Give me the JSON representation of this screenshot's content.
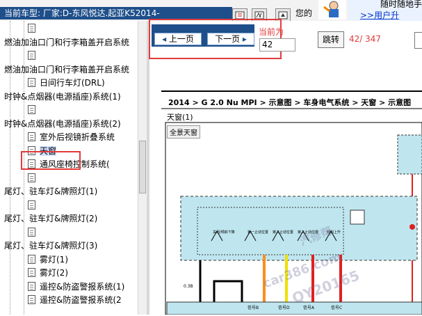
{
  "header": {
    "title": "当前车型:  厂家:D-东风悦达.起亚K52014-",
    "notice": "您的",
    "ad_line1": "随时随地手",
    "ad_link": ">>用户升"
  },
  "sidebar": {
    "items": [
      {
        "label": "",
        "level": 2,
        "icon": "doc"
      },
      {
        "label": "燃油加油口门和行李箱盖开启系统",
        "level": 0,
        "icon": "folder"
      },
      {
        "label": "",
        "level": 2,
        "icon": "doc"
      },
      {
        "label": "燃油加油口门和行李箱盖开启系统",
        "level": 0,
        "icon": "folder"
      },
      {
        "label": "日间行车灯(DRL)",
        "level": 2,
        "icon": "doc"
      },
      {
        "label": "时钟&点烟器(电源插座)系统(1)",
        "level": 0,
        "icon": "folder"
      },
      {
        "label": "",
        "level": 2,
        "icon": "doc"
      },
      {
        "label": "时钟&点烟器(电源插座)系统(2)",
        "level": 0,
        "icon": "folder"
      },
      {
        "label": "室外后视镜折叠系统",
        "level": 2,
        "icon": "doc"
      },
      {
        "label": "天窗",
        "level": 2,
        "icon": "doc",
        "selected": true
      },
      {
        "label": "通风座椅控制系统(",
        "level": 2,
        "icon": "doc"
      },
      {
        "label": "",
        "level": 2,
        "icon": "doc"
      },
      {
        "label": "尾灯、驻车灯&牌照灯(1)",
        "level": 0,
        "icon": "folder"
      },
      {
        "label": "",
        "level": 2,
        "icon": "doc"
      },
      {
        "label": "尾灯、驻车灯&牌照灯(2)",
        "level": 0,
        "icon": "folder"
      },
      {
        "label": "",
        "level": 2,
        "icon": "doc"
      },
      {
        "label": "尾灯、驻车灯&牌照灯(3)",
        "level": 0,
        "icon": "folder"
      },
      {
        "label": "雾灯(1)",
        "level": 2,
        "icon": "doc"
      },
      {
        "label": "雾灯(2)",
        "level": 2,
        "icon": "doc"
      },
      {
        "label": "遥控&防盗警报系统(1)",
        "level": 2,
        "icon": "doc"
      },
      {
        "label": "遥控&防盗警报系统(2",
        "level": 2,
        "icon": "doc"
      }
    ]
  },
  "nav": {
    "prev_label": "上一页",
    "next_label": "下一页",
    "current_label": "当前为",
    "page_value": "42",
    "jump_label": "跳转",
    "page_count": "42/ 347"
  },
  "diagram": {
    "breadcrumb": "2014 > G 2.0 Nu MPI > 示意图 > 车身电气系统 > 天窗 > 示意图",
    "section_label": "天窗(1)",
    "subsection_label": "全景天窗",
    "box_labels": [
      "关闭/倾斜下降",
      "第一止动位置",
      "第二止动位置",
      "第二止动位置",
      "倾斜上升"
    ],
    "connector_labels": [
      "信号B",
      "信号D",
      "信号A",
      "信号C"
    ],
    "wire_label": "0.3B",
    "watermark": [
      "car386.com",
      "QY20165",
      "汽修帮"
    ]
  },
  "colors": {
    "title_bg": "#1e4f8a",
    "highlight_red": "#e23a3a",
    "diagram_panel": "#bfe6ef",
    "wire_red": "#e02020",
    "wire_orange": "#ff8c1a",
    "wire_yellow": "#f0e000"
  }
}
